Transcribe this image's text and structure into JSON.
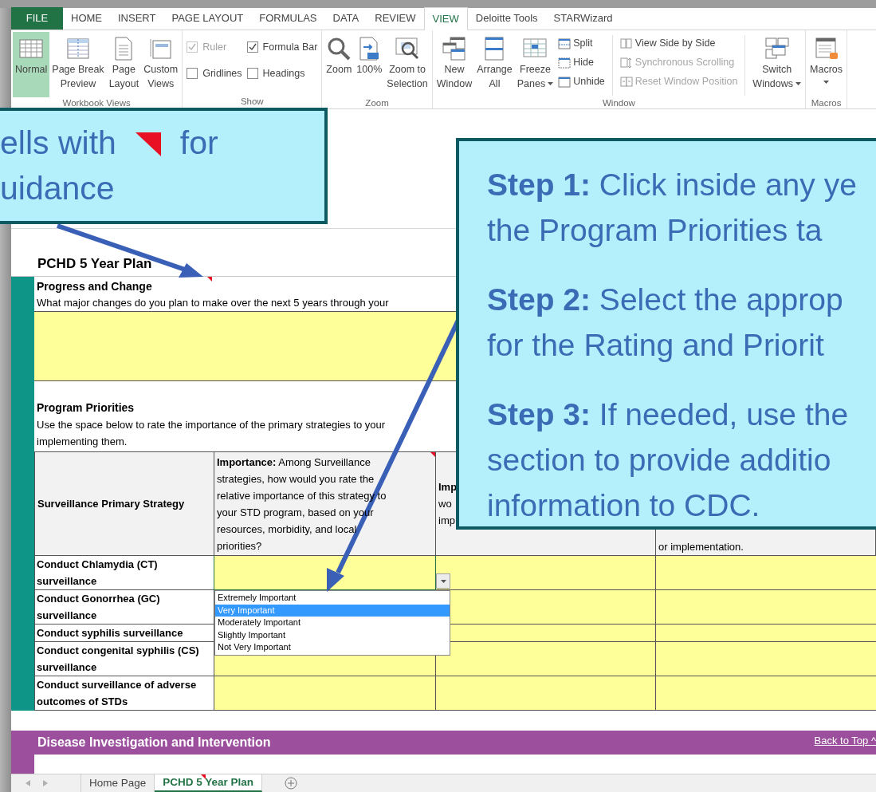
{
  "ribbon_tabs": [
    {
      "label": "FILE",
      "kind": "file",
      "selected": false
    },
    {
      "label": "HOME",
      "kind": "tab",
      "selected": false
    },
    {
      "label": "INSERT",
      "kind": "tab",
      "selected": false
    },
    {
      "label": "PAGE LAYOUT",
      "kind": "tab",
      "selected": false
    },
    {
      "label": "FORMULAS",
      "kind": "tab",
      "selected": false
    },
    {
      "label": "DATA",
      "kind": "tab",
      "selected": false
    },
    {
      "label": "REVIEW",
      "kind": "tab",
      "selected": false
    },
    {
      "label": "VIEW",
      "kind": "tab",
      "selected": true
    },
    {
      "label": "Deloitte Tools",
      "kind": "tab",
      "selected": false
    },
    {
      "label": "STARWizard",
      "kind": "tab",
      "selected": false
    }
  ],
  "ribbon_groups": [
    {
      "label": "Workbook Views",
      "items": [
        {
          "kind": "large",
          "lines": [
            "Normal"
          ],
          "selected": true
        },
        {
          "kind": "large",
          "lines": [
            "Page Break",
            "Preview"
          ],
          "selected": false
        },
        {
          "kind": "large",
          "lines": [
            "Page",
            "Layout"
          ],
          "selected": false
        },
        {
          "kind": "large",
          "lines": [
            "Custom",
            "Views"
          ],
          "selected": false
        }
      ]
    },
    {
      "label": "Show",
      "items": [
        {
          "kind": "stack",
          "items": [
            {
              "kind": "checkbox",
              "label": "Ruler",
              "checked": true,
              "disabled": true
            },
            {
              "kind": "checkbox",
              "label": "Gridlines",
              "checked": false,
              "disabled": false
            }
          ]
        },
        {
          "kind": "stack",
          "items": [
            {
              "kind": "checkbox",
              "label": "Formula Bar",
              "checked": true,
              "disabled": false
            },
            {
              "kind": "checkbox",
              "label": "Headings",
              "checked": false,
              "disabled": false
            }
          ]
        }
      ]
    },
    {
      "label": "Zoom",
      "items": [
        {
          "kind": "large",
          "lines": [
            "Zoom"
          ]
        },
        {
          "kind": "large",
          "lines": [
            "100%"
          ]
        },
        {
          "kind": "large",
          "lines": [
            "Zoom to",
            "Selection"
          ]
        }
      ]
    },
    {
      "label": "Window",
      "items": [
        {
          "kind": "large",
          "lines": [
            "New",
            "Window"
          ]
        },
        {
          "kind": "large",
          "lines": [
            "Arrange",
            "All"
          ]
        },
        {
          "kind": "large",
          "lines": [
            "Freeze",
            "Panes"
          ],
          "dropdown": true
        },
        {
          "kind": "stack",
          "items": [
            {
              "kind": "small",
              "label": "Split",
              "disabled": false
            },
            {
              "kind": "small",
              "label": "Hide",
              "disabled": false
            },
            {
              "kind": "small",
              "label": "Unhide",
              "disabled": false
            }
          ]
        },
        {
          "kind": "separator"
        },
        {
          "kind": "stack",
          "items": [
            {
              "kind": "small",
              "label": "View Side by Side",
              "disabled": false
            },
            {
              "kind": "small",
              "label": "Synchronous Scrolling",
              "disabled": true
            },
            {
              "kind": "small",
              "label": "Reset Window Position",
              "disabled": true
            }
          ]
        },
        {
          "kind": "separator"
        },
        {
          "kind": "large",
          "lines": [
            "Switch",
            "Windows"
          ],
          "dropdown": true
        }
      ]
    },
    {
      "label": "Macros",
      "items": [
        {
          "kind": "large",
          "lines": [
            "Macros"
          ],
          "dropdown": true
        }
      ]
    }
  ],
  "sheet": {
    "title": "PCHD 5 Year Plan",
    "progress": {
      "heading": "Progress and Change",
      "question": "What major changes do you plan to make over the next 5 years through your",
      "comment": true
    },
    "priorities": {
      "heading": "Program Priorities",
      "lines": [
        "Use the space below to rate the importance of the primary strategies to your",
        "implementing them."
      ]
    },
    "table": {
      "columns": [
        {
          "kind": "plain",
          "text": "Surveillance Primary Strategy"
        },
        {
          "kind": "rich",
          "lines": [
            "**Importance:** Among Surveillance",
            "strategies, how would you rate the",
            "relative importance of this strategy to",
            "your STD program, based on your",
            "resources, morbidity, and local",
            "priorities?"
          ],
          "comment": true
        },
        {
          "kind": "lines",
          "lines": [
            "**Imp**",
            "wo",
            "imp"
          ]
        },
        {
          "kind": "bottom",
          "text": "or implementation."
        }
      ],
      "rows": [
        {
          "strategy": "Conduct Chlamydia (CT) surveillance",
          "selected": true
        },
        {
          "strategy": "Conduct Gonorrhea (GC) surveillance",
          "selected": false
        },
        {
          "strategy": "Conduct syphilis surveillance",
          "selected": false
        },
        {
          "strategy": "Conduct congenital syphilis (CS) surveillance",
          "selected": false
        },
        {
          "strategy": "Conduct surveillance of adverse outcomes of STDs",
          "selected": false
        }
      ]
    },
    "dropdown": {
      "options": [
        {
          "label": "Extremely Important",
          "selected": false
        },
        {
          "label": "Very Important",
          "selected": true
        },
        {
          "label": "Moderately Important",
          "selected": false
        },
        {
          "label": "Slightly Important",
          "selected": false
        },
        {
          "label": "Not Very Important",
          "selected": false
        }
      ]
    },
    "section_bar": {
      "title": "Disease Investigation and Intervention",
      "link": "Back to Top ^"
    }
  },
  "sheet_tabs": [
    {
      "label": "Home Page",
      "selected": false,
      "comment": false
    },
    {
      "label": "PCHD 5 Year Plan",
      "selected": true,
      "comment": true
    }
  ],
  "callouts": {
    "guidance": {
      "before": "ells with",
      "after": "for",
      "second_line": "uidance"
    },
    "steps": [
      {
        "lines": [
          "**Step 1:** Click inside any ye",
          "the Program Priorities ta"
        ]
      },
      {
        "lines": [
          "**Step 2:** Select the approp",
          "for the Rating and Priorit"
        ]
      },
      {
        "lines": [
          "**Step 3:** If needed, use the",
          "section to provide additio",
          "information to CDC."
        ]
      }
    ]
  }
}
